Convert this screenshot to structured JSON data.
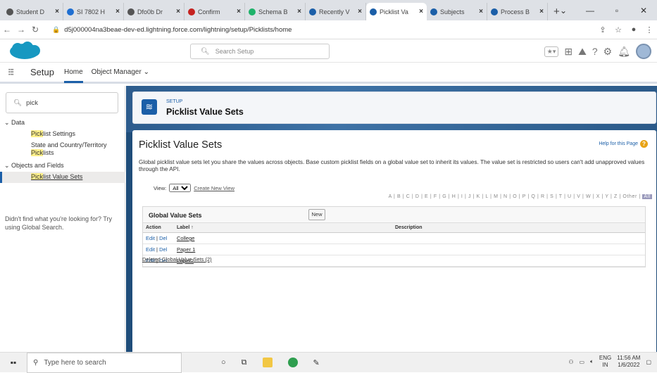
{
  "browser": {
    "tabs": [
      {
        "title": "Student D",
        "color": "#555"
      },
      {
        "title": "SI 7802 H",
        "color": "#1f6fd1"
      },
      {
        "title": "Dfo0b Dr",
        "color": "#555"
      },
      {
        "title": "Confirm",
        "color": "#c5221f"
      },
      {
        "title": "Schema B",
        "color": "#1eb26a"
      },
      {
        "title": "Recently V",
        "color": "#1b5fa8"
      },
      {
        "title": "Picklist Va",
        "color": "#1b5fa8",
        "active": true
      },
      {
        "title": "Subjects",
        "color": "#1b5fa8"
      },
      {
        "title": "Process B",
        "color": "#1b5fa8"
      }
    ],
    "url": "d5j000004na3beae-dev-ed.lightning.force.com/lightning/setup/Picklists/home"
  },
  "header": {
    "search_placeholder": "Search Setup"
  },
  "appnav": {
    "app_name": "Setup",
    "tabs": [
      "Home",
      "Object Manager"
    ]
  },
  "sidebar": {
    "quickfind_value": "pick",
    "groups": [
      {
        "label": "Data",
        "items": [
          "Picklist Settings",
          "State and Country/Territory Picklists"
        ]
      },
      {
        "label": "Objects and Fields",
        "items": [
          "Picklist Value Sets"
        ]
      }
    ],
    "not_found": "Didn't find what you're looking for? Try using Global Search."
  },
  "banner": {
    "supertitle": "SETUP",
    "title": "Picklist Value Sets"
  },
  "page": {
    "title": "Picklist Value Sets",
    "help": "Help for this Page",
    "description": "Global picklist value sets let you share the values across objects. Base custom picklist fields on a global value set to inherit its values. The value set is restricted so users can't add unapproved values through the API.",
    "views_label": "View:",
    "views_selected": "All",
    "create_view": "Create New View",
    "alphabet": "A | B | C | D | E | F | G | H | I | J | K | L | M | N | O | P | Q | R | S | T | U | V | W | X | Y | Z | Other",
    "alphabet_all": "All",
    "section_title": "Global Value Sets",
    "new_button": "New",
    "columns": [
      "Action",
      "Label ↑",
      "Description"
    ],
    "rows": [
      {
        "edit": "Edit",
        "del": "Del",
        "label": "College",
        "description": ""
      },
      {
        "edit": "Edit",
        "del": "Del",
        "label": "Paper 1",
        "description": ""
      },
      {
        "edit": "Edit",
        "del": "Del",
        "label": "Paper2",
        "description": ""
      }
    ],
    "deleted_link": "Deleted Global Value Sets (2)"
  },
  "taskbar": {
    "search_placeholder": "Type here to search",
    "lang": "ENG",
    "region": "IN",
    "time": "11:56 AM",
    "date": "1/6/2022"
  }
}
